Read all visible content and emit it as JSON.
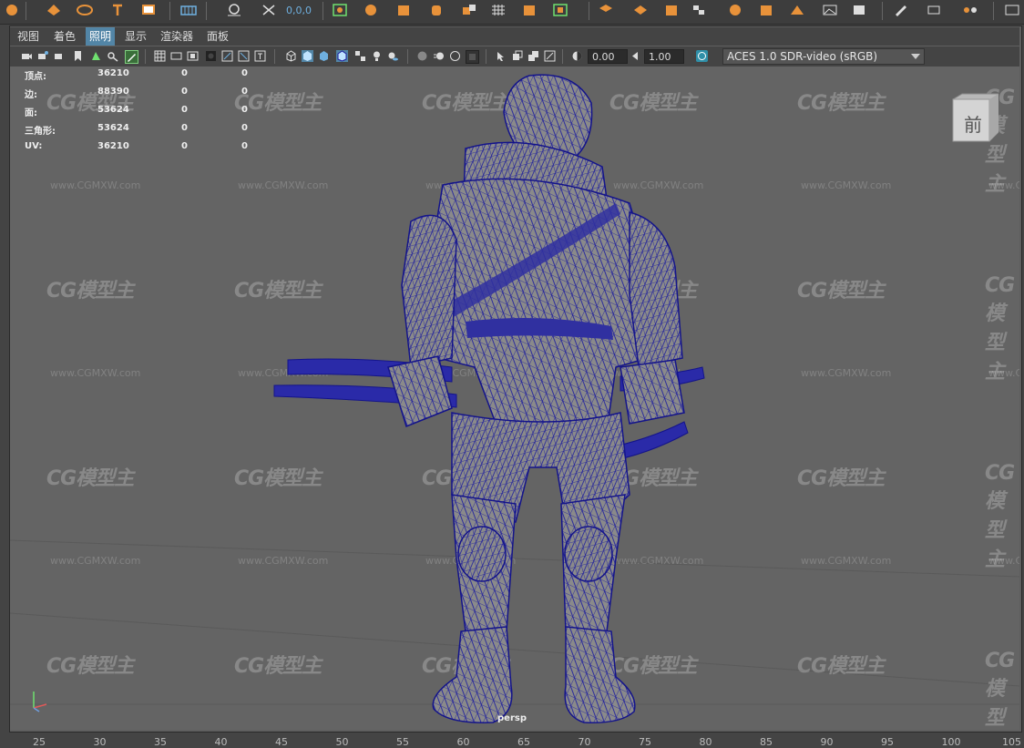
{
  "toolbar": {
    "coordinate_readout": "0,0,0"
  },
  "menu": {
    "items": [
      "视图",
      "着色",
      "照明",
      "显示",
      "渲染器",
      "面板"
    ],
    "active_index": 2
  },
  "panel_toolbar": {
    "exposure_value": "0.00",
    "gamma_value": "1.00",
    "color_management": "ACES 1.0 SDR-video (sRGB)"
  },
  "hud": {
    "rows": [
      {
        "label": "顶点:",
        "v1": "36210",
        "v2": "0",
        "v3": "0"
      },
      {
        "label": "边:",
        "v1": "88390",
        "v2": "0",
        "v3": "0"
      },
      {
        "label": "面:",
        "v1": "53624",
        "v2": "0",
        "v3": "0"
      },
      {
        "label": "三角形:",
        "v1": "53624",
        "v2": "0",
        "v3": "0"
      },
      {
        "label": "UV:",
        "v1": "36210",
        "v2": "0",
        "v3": "0"
      }
    ]
  },
  "viewcube": {
    "face_label": "前"
  },
  "viewport": {
    "camera_label": "persp",
    "watermark_logo": "CG模型主",
    "watermark_url": "www.CGMXW.com"
  },
  "ruler": {
    "ticks": [
      "25",
      "30",
      "35",
      "40",
      "45",
      "50",
      "55",
      "60",
      "65",
      "70",
      "75",
      "80",
      "85",
      "90",
      "95",
      "100",
      "105"
    ]
  },
  "colors": {
    "wireframe": "#1b1b9e",
    "mesh_fill": "#8a8a8a",
    "viewport_bg": "#646464",
    "accent": "#5285a6",
    "shelf_orange": "#e8923a"
  }
}
